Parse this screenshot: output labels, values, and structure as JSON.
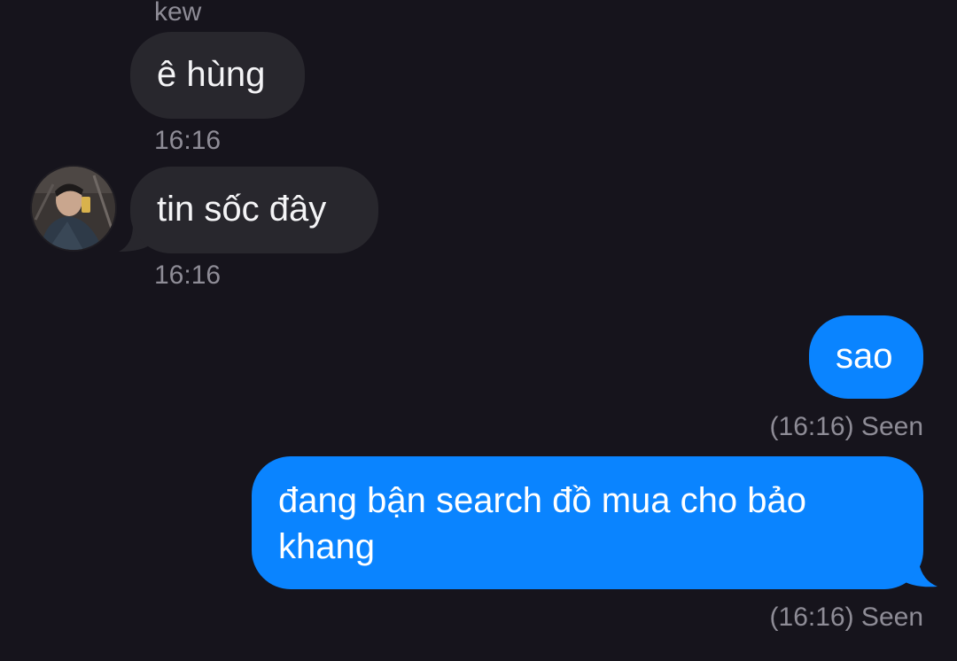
{
  "conversation": {
    "contact_name": "kew",
    "messages": [
      {
        "direction": "incoming",
        "text": "ê hùng",
        "time": "16:16"
      },
      {
        "direction": "incoming",
        "text": "tin sốc đây",
        "time": "16:16"
      },
      {
        "direction": "outgoing",
        "text": "sao",
        "status": "(16:16) Seen"
      },
      {
        "direction": "outgoing",
        "text_line1": "đang bận search đồ mua cho bảo",
        "text_line2": "khang",
        "status": "(16:16) Seen"
      }
    ]
  },
  "avatar_icon": "user-avatar-icon",
  "colors": {
    "background": "#16141c",
    "incoming_bubble": "#28272d",
    "outgoing_bubble": "#0a84ff",
    "meta_text": "#8e8c96"
  }
}
